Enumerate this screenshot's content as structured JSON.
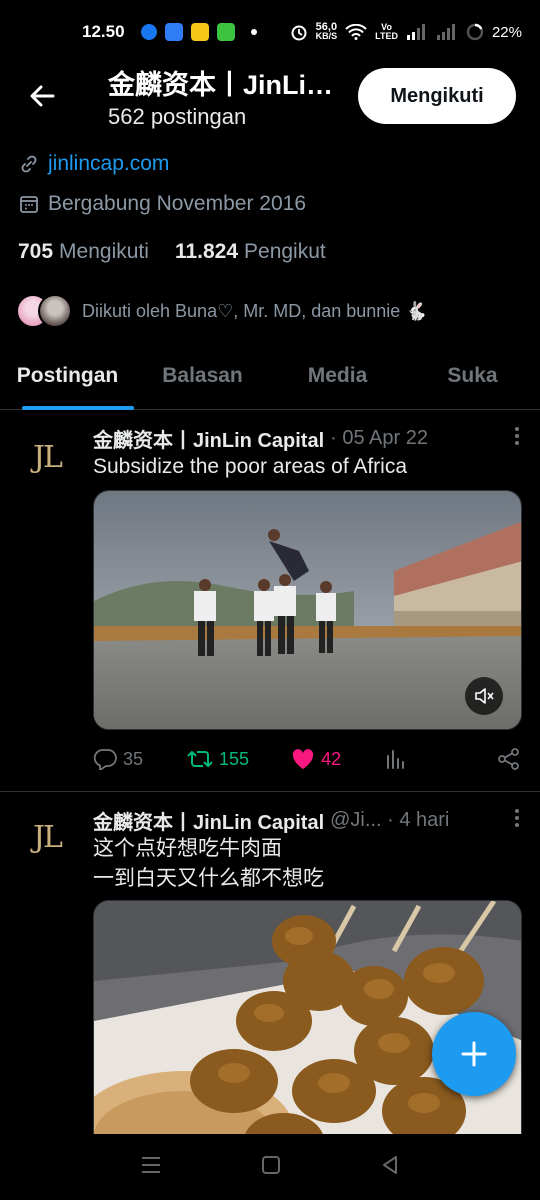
{
  "status_bar": {
    "time": "12.50",
    "net_speed_value": "56,0",
    "net_speed_unit": "KB/S",
    "volte_top": "Vo",
    "volte_bottom": "LTED",
    "battery": "22%"
  },
  "header": {
    "title": "金麟资本丨JinLin Capital",
    "post_count": "562 postingan",
    "follow_label": "Mengikuti"
  },
  "profile": {
    "website": "jinlincap.com",
    "joined": "Bergabung November 2016",
    "following_count": "705",
    "following_label": "Mengikuti",
    "followers_count": "11.824",
    "followers_label": "Pengikut",
    "followed_by": "Diikuti oleh Buna♡, Mr. MD, dan bunnie 🐇"
  },
  "tabs": [
    {
      "label": "Postingan"
    },
    {
      "label": "Balasan"
    },
    {
      "label": "Media"
    },
    {
      "label": "Suka"
    }
  ],
  "tweets": [
    {
      "avatar_text": "JL",
      "name": "金麟资本丨JinLin Capital",
      "meta": "· 05 Apr 22",
      "text": "Subsidize the poor areas of Africa",
      "replies": "35",
      "retweets": "155",
      "likes": "42"
    },
    {
      "avatar_text": "JL",
      "name": "金麟资本丨JinLin Capital",
      "meta": "@Ji... · 4 hari",
      "text_line1": "这个点好想吃牛肉面",
      "text_line2": "一到白天又什么都不想吃"
    }
  ],
  "colors": {
    "accent": "#1d9bf0",
    "retweet": "#00ba7c",
    "like": "#f91880",
    "muted": "#71767b",
    "background": "#000000"
  }
}
